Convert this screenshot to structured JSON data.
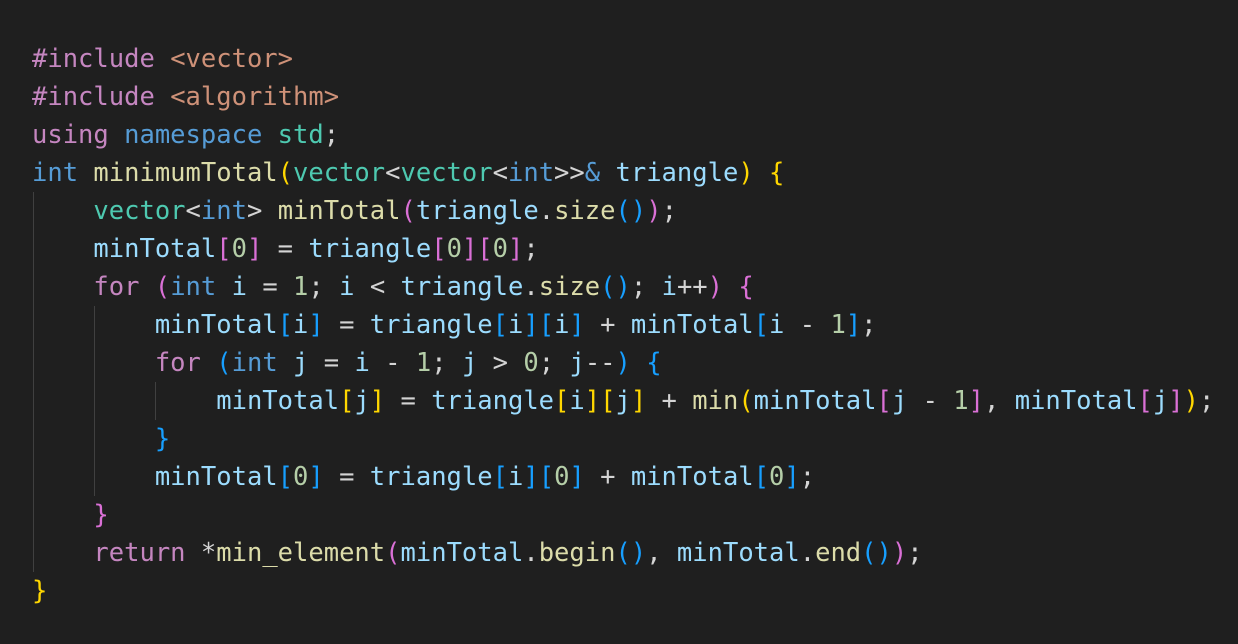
{
  "editor": {
    "language": "cpp",
    "colors": {
      "background": "#1f1f1f",
      "keyword": "#569cd6",
      "control": "#c586c0",
      "string": "#ce9178",
      "type": "#4ec9b0",
      "function": "#dcdcaa",
      "variable": "#9cdcfe",
      "number": "#b5cea8",
      "bracket_level_1": "#ffd700",
      "bracket_level_2": "#da70d6",
      "bracket_level_3": "#179fff"
    },
    "lines": [
      [
        [
          "t-include",
          "#include"
        ],
        [
          "t-punc",
          " "
        ],
        [
          "t-header",
          "<vector>"
        ]
      ],
      [
        [
          "t-include",
          "#include"
        ],
        [
          "t-punc",
          " "
        ],
        [
          "t-header",
          "<algorithm>"
        ]
      ],
      [
        [
          "t-control",
          "using"
        ],
        [
          "t-punc",
          " "
        ],
        [
          "t-keyword",
          "namespace"
        ],
        [
          "t-punc",
          " "
        ],
        [
          "t-ns",
          "std"
        ],
        [
          "t-punc",
          ";"
        ]
      ],
      [
        [
          "t-keyword",
          "int"
        ],
        [
          "t-punc",
          " "
        ],
        [
          "t-func",
          "minimumTotal"
        ],
        [
          "b1",
          "("
        ],
        [
          "t-type",
          "vector"
        ],
        [
          "t-punc",
          "<"
        ],
        [
          "t-type",
          "vector"
        ],
        [
          "t-punc",
          "<"
        ],
        [
          "t-keyword",
          "int"
        ],
        [
          "t-punc",
          ">>"
        ],
        [
          "t-keyword",
          "&"
        ],
        [
          "t-punc",
          " "
        ],
        [
          "t-var",
          "triangle"
        ],
        [
          "b1",
          ")"
        ],
        [
          "t-punc",
          " "
        ],
        [
          "b1",
          "{"
        ]
      ],
      [
        [
          "t-punc",
          "    "
        ],
        [
          "t-type",
          "vector"
        ],
        [
          "t-punc",
          "<"
        ],
        [
          "t-keyword",
          "int"
        ],
        [
          "t-punc",
          "> "
        ],
        [
          "t-func",
          "minTotal"
        ],
        [
          "b2",
          "("
        ],
        [
          "t-var",
          "triangle"
        ],
        [
          "t-punc",
          "."
        ],
        [
          "t-func",
          "size"
        ],
        [
          "b3",
          "()"
        ],
        [
          "b2",
          ")"
        ],
        [
          "t-punc",
          ";"
        ]
      ],
      [
        [
          "t-punc",
          "    "
        ],
        [
          "t-var",
          "minTotal"
        ],
        [
          "b2",
          "["
        ],
        [
          "t-number",
          "0"
        ],
        [
          "b2",
          "]"
        ],
        [
          "t-op",
          " = "
        ],
        [
          "t-var",
          "triangle"
        ],
        [
          "b2",
          "["
        ],
        [
          "t-number",
          "0"
        ],
        [
          "b2",
          "]["
        ],
        [
          "t-number",
          "0"
        ],
        [
          "b2",
          "]"
        ],
        [
          "t-punc",
          ";"
        ]
      ],
      [
        [
          "t-punc",
          "    "
        ],
        [
          "t-control",
          "for"
        ],
        [
          "t-punc",
          " "
        ],
        [
          "b2",
          "("
        ],
        [
          "t-keyword",
          "int"
        ],
        [
          "t-punc",
          " "
        ],
        [
          "t-var",
          "i"
        ],
        [
          "t-op",
          " = "
        ],
        [
          "t-number",
          "1"
        ],
        [
          "t-punc",
          "; "
        ],
        [
          "t-var",
          "i"
        ],
        [
          "t-op",
          " < "
        ],
        [
          "t-var",
          "triangle"
        ],
        [
          "t-punc",
          "."
        ],
        [
          "t-func",
          "size"
        ],
        [
          "b3",
          "()"
        ],
        [
          "t-punc",
          "; "
        ],
        [
          "t-var",
          "i"
        ],
        [
          "t-op",
          "++"
        ],
        [
          "b2",
          ")"
        ],
        [
          "t-punc",
          " "
        ],
        [
          "b2",
          "{"
        ]
      ],
      [
        [
          "t-punc",
          "        "
        ],
        [
          "t-var",
          "minTotal"
        ],
        [
          "b3",
          "["
        ],
        [
          "t-var",
          "i"
        ],
        [
          "b3",
          "]"
        ],
        [
          "t-op",
          " = "
        ],
        [
          "t-var",
          "triangle"
        ],
        [
          "b3",
          "["
        ],
        [
          "t-var",
          "i"
        ],
        [
          "b3",
          "]["
        ],
        [
          "t-var",
          "i"
        ],
        [
          "b3",
          "]"
        ],
        [
          "t-op",
          " + "
        ],
        [
          "t-var",
          "minTotal"
        ],
        [
          "b3",
          "["
        ],
        [
          "t-var",
          "i"
        ],
        [
          "t-op",
          " - "
        ],
        [
          "t-number",
          "1"
        ],
        [
          "b3",
          "]"
        ],
        [
          "t-punc",
          ";"
        ]
      ],
      [
        [
          "t-punc",
          "        "
        ],
        [
          "t-control",
          "for"
        ],
        [
          "t-punc",
          " "
        ],
        [
          "b3",
          "("
        ],
        [
          "t-keyword",
          "int"
        ],
        [
          "t-punc",
          " "
        ],
        [
          "t-var",
          "j"
        ],
        [
          "t-op",
          " = "
        ],
        [
          "t-var",
          "i"
        ],
        [
          "t-op",
          " - "
        ],
        [
          "t-number",
          "1"
        ],
        [
          "t-punc",
          "; "
        ],
        [
          "t-var",
          "j"
        ],
        [
          "t-op",
          " > "
        ],
        [
          "t-number",
          "0"
        ],
        [
          "t-punc",
          "; "
        ],
        [
          "t-var",
          "j"
        ],
        [
          "t-op",
          "--"
        ],
        [
          "b3",
          ")"
        ],
        [
          "t-punc",
          " "
        ],
        [
          "b3",
          "{"
        ]
      ],
      [
        [
          "t-punc",
          "            "
        ],
        [
          "t-var",
          "minTotal"
        ],
        [
          "b1",
          "["
        ],
        [
          "t-var",
          "j"
        ],
        [
          "b1",
          "]"
        ],
        [
          "t-op",
          " = "
        ],
        [
          "t-var",
          "triangle"
        ],
        [
          "b1",
          "["
        ],
        [
          "t-var",
          "i"
        ],
        [
          "b1",
          "]["
        ],
        [
          "t-var",
          "j"
        ],
        [
          "b1",
          "]"
        ],
        [
          "t-op",
          " + "
        ],
        [
          "t-func",
          "min"
        ],
        [
          "b1",
          "("
        ],
        [
          "t-var",
          "minTotal"
        ],
        [
          "b2",
          "["
        ],
        [
          "t-var",
          "j"
        ],
        [
          "t-op",
          " - "
        ],
        [
          "t-number",
          "1"
        ],
        [
          "b2",
          "]"
        ],
        [
          "t-punc",
          ", "
        ],
        [
          "t-var",
          "minTotal"
        ],
        [
          "b2",
          "["
        ],
        [
          "t-var",
          "j"
        ],
        [
          "b2",
          "]"
        ],
        [
          "b1",
          ")"
        ],
        [
          "t-punc",
          ";"
        ]
      ],
      [
        [
          "t-punc",
          "        "
        ],
        [
          "b3",
          "}"
        ]
      ],
      [
        [
          "t-punc",
          "        "
        ],
        [
          "t-var",
          "minTotal"
        ],
        [
          "b3",
          "["
        ],
        [
          "t-number",
          "0"
        ],
        [
          "b3",
          "]"
        ],
        [
          "t-op",
          " = "
        ],
        [
          "t-var",
          "triangle"
        ],
        [
          "b3",
          "["
        ],
        [
          "t-var",
          "i"
        ],
        [
          "b3",
          "]["
        ],
        [
          "t-number",
          "0"
        ],
        [
          "b3",
          "]"
        ],
        [
          "t-op",
          " + "
        ],
        [
          "t-var",
          "minTotal"
        ],
        [
          "b3",
          "["
        ],
        [
          "t-number",
          "0"
        ],
        [
          "b3",
          "]"
        ],
        [
          "t-punc",
          ";"
        ]
      ],
      [
        [
          "t-punc",
          "    "
        ],
        [
          "b2",
          "}"
        ]
      ],
      [
        [
          "t-punc",
          "    "
        ],
        [
          "t-control",
          "return"
        ],
        [
          "t-punc",
          " "
        ],
        [
          "t-op",
          "*"
        ],
        [
          "t-func",
          "min_element"
        ],
        [
          "b2",
          "("
        ],
        [
          "t-var",
          "minTotal"
        ],
        [
          "t-punc",
          "."
        ],
        [
          "t-func",
          "begin"
        ],
        [
          "b3",
          "()"
        ],
        [
          "t-punc",
          ", "
        ],
        [
          "t-var",
          "minTotal"
        ],
        [
          "t-punc",
          "."
        ],
        [
          "t-func",
          "end"
        ],
        [
          "b3",
          "()"
        ],
        [
          "b2",
          ")"
        ],
        [
          "t-punc",
          ";"
        ]
      ],
      [
        [
          "b1",
          "}"
        ]
      ]
    ]
  }
}
